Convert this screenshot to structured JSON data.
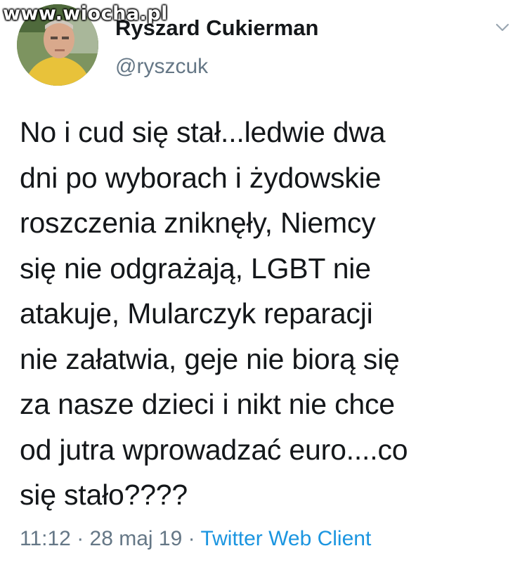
{
  "watermark": "www.wiocha.pl",
  "tweet": {
    "display_name": "Ryszard Cukierman",
    "handle": "@ryszcuk",
    "text": "No i cud się stał...ledwie dwa\ndni po wyborach i żydowskie\nroszczenia zniknęły, Niemcy\nsię nie odgrażają, LGBT nie\natakuje, Mularczyk reparacji\nnie załatwia, geje nie biorą się\nza nasze dzieci i nikt nie chce\nod jutra wprowadzać euro....co\nsię stało????",
    "time": "11:12",
    "separator": "·",
    "date": "28 maj 19",
    "source": "Twitter Web Client"
  },
  "icons": {
    "more": "chevron-down-icon",
    "avatar": "user-avatar"
  },
  "colors": {
    "text": "#14171a",
    "secondary": "#657786",
    "link": "#1b95e0"
  }
}
